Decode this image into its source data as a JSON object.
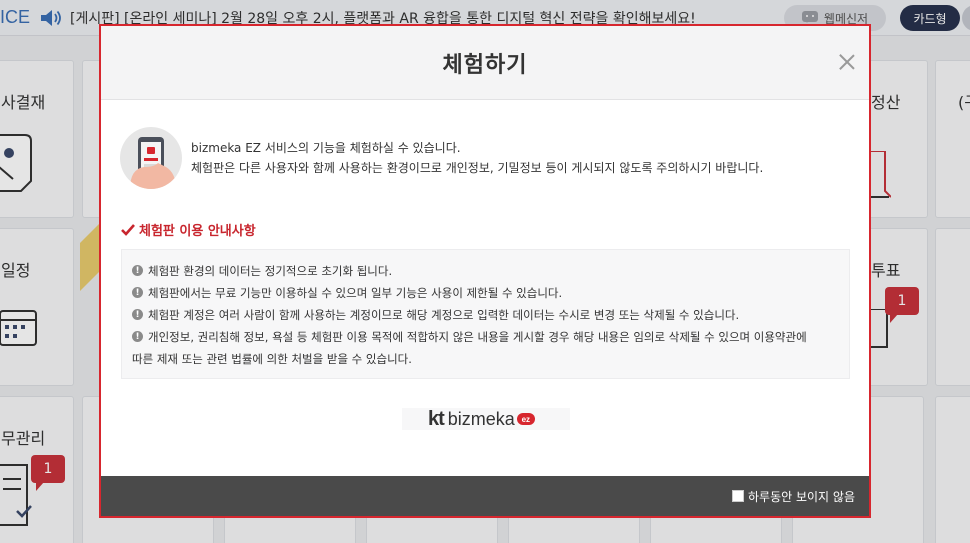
{
  "notice_bar": {
    "brand": "ICE",
    "speaker_icon": "speaker-icon",
    "text": "[게시판] [온라인 세미나] 2월 28일 오후 2시, 플랫폼과 AR 융합을 통한 디지털 혁신 전략을 확인해보세요!",
    "webmessenger_label": "웹메신저",
    "card_label": "카드형"
  },
  "tiles": {
    "approval_title": "사결재",
    "schedule_title": "일정",
    "task_title": "무관리",
    "expense_title": "정산",
    "right_title": "(구",
    "vote_title": "투표",
    "vote_badge": "1",
    "task_badge": "1"
  },
  "modal": {
    "title": "체험하기",
    "intro_line1": "bizmeka EZ 서비스의 기능을 체험하실 수 있습니다.",
    "intro_line2": "체험판은 다른 사용자와 함께 사용하는 환경이므로 개인정보, 기밀정보 등이 게시되지 않도록 주의하시기 바랍니다.",
    "section_title": "체험판 이용 안내사항",
    "notices": [
      "체험판 환경의 데이터는 정기적으로 초기화 됩니다.",
      "체험판에서는 무료 기능만 이용하실 수 있으며 일부 기능은 사용이 제한될 수 있습니다.",
      "체험판 계정은 여러 사람이 함께 사용하는 계정이므로 해당 계정으로 입력한 데이터는 수시로 변경 또는 삭제될 수 있습니다.",
      "개인정보, 권리침해 정보, 욕설 등 체험판 이용 목적에 적합하지 않은 내용을 게시할 경우 해당 내용은 임의로 삭제될 수 있으며 이용약관에"
    ],
    "notice_continuation": "따른 제재 또는 관련 법률에 의한 처벌을 받을 수 있습니다.",
    "logo_kt": "kt",
    "logo_biz": "bizmeka",
    "logo_ez": "ez",
    "dismiss_label": "하루동안 보이지 않음"
  },
  "colors": {
    "accent_red": "#d7262e",
    "footer": "#4a4a4a",
    "card_button": "#27324d"
  }
}
